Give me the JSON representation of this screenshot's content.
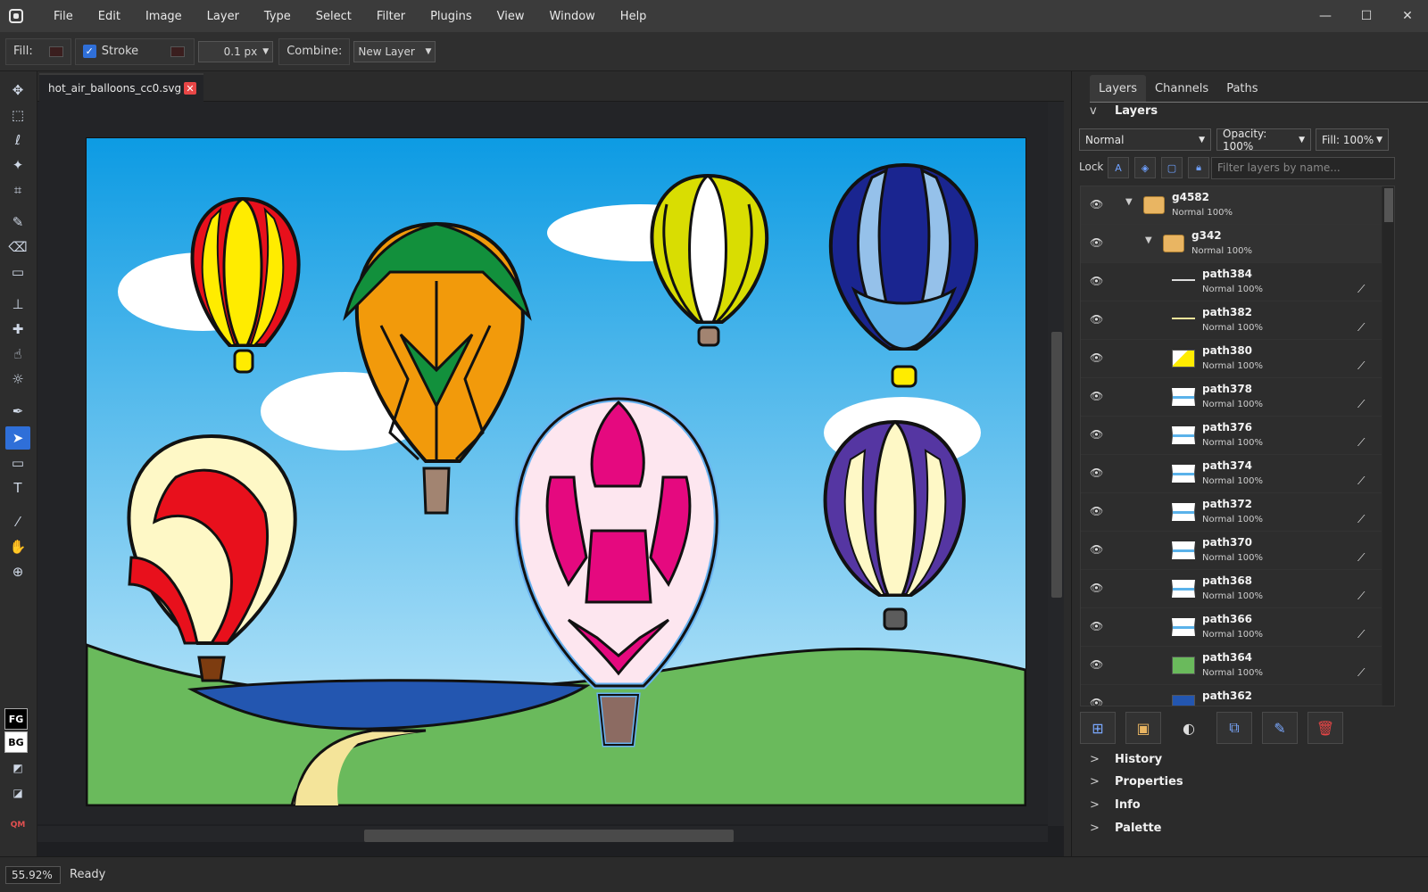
{
  "menu": [
    "File",
    "Edit",
    "Image",
    "Layer",
    "Type",
    "Select",
    "Filter",
    "Plugins",
    "View",
    "Window",
    "Help"
  ],
  "window_controls": {
    "minimize": "—",
    "maximize": "☐",
    "close": "✕"
  },
  "options": {
    "fill_label": "Fill:",
    "stroke_label": "Stroke",
    "stroke_checked": true,
    "stroke_width": "0.1 px",
    "combine_label": "Combine:",
    "combine_value": "New Layer"
  },
  "toolbox": {
    "fg": "FG",
    "bg": "BG",
    "qm": "QM"
  },
  "document": {
    "tab_name": "hot_air_balloons_cc0.svg",
    "close": "✕"
  },
  "panel": {
    "tabs": [
      "Layers",
      "Channels",
      "Paths"
    ],
    "layers_header": "Layers",
    "layers_toggle": "v",
    "blend_mode": "Normal",
    "opacity": "Opacity: 100%",
    "fill": "Fill: 100%",
    "lock_label": "Lock",
    "filter_placeholder": "Filter layers by name...",
    "layers": [
      {
        "name": "g4582",
        "sub": "Normal  100%",
        "kind": "group",
        "depth": 0
      },
      {
        "name": "g342",
        "sub": "Normal  100%",
        "kind": "group",
        "depth": 1
      },
      {
        "name": "path384",
        "sub": "Normal  100%",
        "kind": "path",
        "thumb": "line-white"
      },
      {
        "name": "path382",
        "sub": "Normal  100%",
        "kind": "path",
        "thumb": "line-yellow"
      },
      {
        "name": "path380",
        "sub": "Normal  100%",
        "kind": "path",
        "thumb": "yellow"
      },
      {
        "name": "path378",
        "sub": "Normal  100%",
        "kind": "path",
        "thumb": "blue-line"
      },
      {
        "name": "path376",
        "sub": "Normal  100%",
        "kind": "path",
        "thumb": "blue-line"
      },
      {
        "name": "path374",
        "sub": "Normal  100%",
        "kind": "path",
        "thumb": "blue-line"
      },
      {
        "name": "path372",
        "sub": "Normal  100%",
        "kind": "path",
        "thumb": "blue-line"
      },
      {
        "name": "path370",
        "sub": "Normal  100%",
        "kind": "path",
        "thumb": "blue-line"
      },
      {
        "name": "path368",
        "sub": "Normal  100%",
        "kind": "path",
        "thumb": "blue-line"
      },
      {
        "name": "path366",
        "sub": "Normal  100%",
        "kind": "path",
        "thumb": "blue-line"
      },
      {
        "name": "path364",
        "sub": "Normal  100%",
        "kind": "path",
        "thumb": "green"
      },
      {
        "name": "path362",
        "sub": "",
        "kind": "path",
        "thumb": "blue"
      }
    ],
    "sections": [
      "History",
      "Properties",
      "Info",
      "Palette"
    ],
    "section_toggle": ">"
  },
  "status": {
    "zoom": "55.92%",
    "text": "Ready"
  },
  "colors": {
    "accent": "#2f6fd8",
    "sky_top": "#0d9be3",
    "sky_bottom": "#c9ecfb",
    "grass": "#6aba5c",
    "water": "#2356b0"
  }
}
